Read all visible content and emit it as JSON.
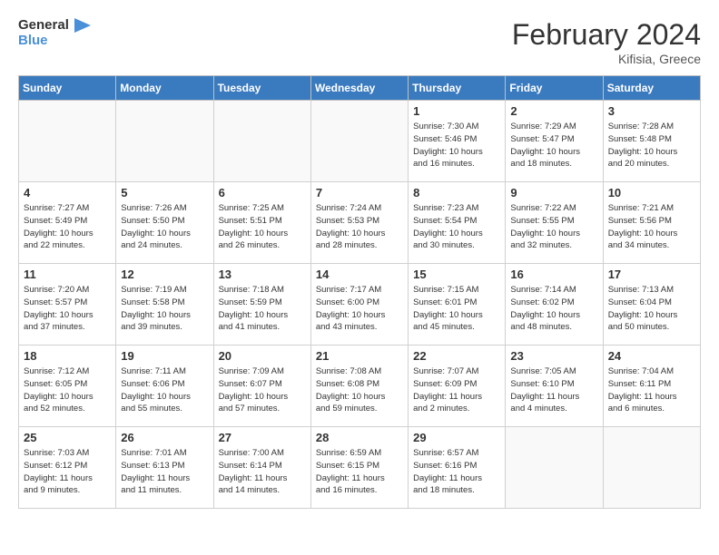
{
  "logo": {
    "line1": "General",
    "line2": "Blue"
  },
  "title": "February 2024",
  "location": "Kifisia, Greece",
  "headers": [
    "Sunday",
    "Monday",
    "Tuesday",
    "Wednesday",
    "Thursday",
    "Friday",
    "Saturday"
  ],
  "weeks": [
    [
      {
        "day": "",
        "info": ""
      },
      {
        "day": "",
        "info": ""
      },
      {
        "day": "",
        "info": ""
      },
      {
        "day": "",
        "info": ""
      },
      {
        "day": "1",
        "info": "Sunrise: 7:30 AM\nSunset: 5:46 PM\nDaylight: 10 hours\nand 16 minutes."
      },
      {
        "day": "2",
        "info": "Sunrise: 7:29 AM\nSunset: 5:47 PM\nDaylight: 10 hours\nand 18 minutes."
      },
      {
        "day": "3",
        "info": "Sunrise: 7:28 AM\nSunset: 5:48 PM\nDaylight: 10 hours\nand 20 minutes."
      }
    ],
    [
      {
        "day": "4",
        "info": "Sunrise: 7:27 AM\nSunset: 5:49 PM\nDaylight: 10 hours\nand 22 minutes."
      },
      {
        "day": "5",
        "info": "Sunrise: 7:26 AM\nSunset: 5:50 PM\nDaylight: 10 hours\nand 24 minutes."
      },
      {
        "day": "6",
        "info": "Sunrise: 7:25 AM\nSunset: 5:51 PM\nDaylight: 10 hours\nand 26 minutes."
      },
      {
        "day": "7",
        "info": "Sunrise: 7:24 AM\nSunset: 5:53 PM\nDaylight: 10 hours\nand 28 minutes."
      },
      {
        "day": "8",
        "info": "Sunrise: 7:23 AM\nSunset: 5:54 PM\nDaylight: 10 hours\nand 30 minutes."
      },
      {
        "day": "9",
        "info": "Sunrise: 7:22 AM\nSunset: 5:55 PM\nDaylight: 10 hours\nand 32 minutes."
      },
      {
        "day": "10",
        "info": "Sunrise: 7:21 AM\nSunset: 5:56 PM\nDaylight: 10 hours\nand 34 minutes."
      }
    ],
    [
      {
        "day": "11",
        "info": "Sunrise: 7:20 AM\nSunset: 5:57 PM\nDaylight: 10 hours\nand 37 minutes."
      },
      {
        "day": "12",
        "info": "Sunrise: 7:19 AM\nSunset: 5:58 PM\nDaylight: 10 hours\nand 39 minutes."
      },
      {
        "day": "13",
        "info": "Sunrise: 7:18 AM\nSunset: 5:59 PM\nDaylight: 10 hours\nand 41 minutes."
      },
      {
        "day": "14",
        "info": "Sunrise: 7:17 AM\nSunset: 6:00 PM\nDaylight: 10 hours\nand 43 minutes."
      },
      {
        "day": "15",
        "info": "Sunrise: 7:15 AM\nSunset: 6:01 PM\nDaylight: 10 hours\nand 45 minutes."
      },
      {
        "day": "16",
        "info": "Sunrise: 7:14 AM\nSunset: 6:02 PM\nDaylight: 10 hours\nand 48 minutes."
      },
      {
        "day": "17",
        "info": "Sunrise: 7:13 AM\nSunset: 6:04 PM\nDaylight: 10 hours\nand 50 minutes."
      }
    ],
    [
      {
        "day": "18",
        "info": "Sunrise: 7:12 AM\nSunset: 6:05 PM\nDaylight: 10 hours\nand 52 minutes."
      },
      {
        "day": "19",
        "info": "Sunrise: 7:11 AM\nSunset: 6:06 PM\nDaylight: 10 hours\nand 55 minutes."
      },
      {
        "day": "20",
        "info": "Sunrise: 7:09 AM\nSunset: 6:07 PM\nDaylight: 10 hours\nand 57 minutes."
      },
      {
        "day": "21",
        "info": "Sunrise: 7:08 AM\nSunset: 6:08 PM\nDaylight: 10 hours\nand 59 minutes."
      },
      {
        "day": "22",
        "info": "Sunrise: 7:07 AM\nSunset: 6:09 PM\nDaylight: 11 hours\nand 2 minutes."
      },
      {
        "day": "23",
        "info": "Sunrise: 7:05 AM\nSunset: 6:10 PM\nDaylight: 11 hours\nand 4 minutes."
      },
      {
        "day": "24",
        "info": "Sunrise: 7:04 AM\nSunset: 6:11 PM\nDaylight: 11 hours\nand 6 minutes."
      }
    ],
    [
      {
        "day": "25",
        "info": "Sunrise: 7:03 AM\nSunset: 6:12 PM\nDaylight: 11 hours\nand 9 minutes."
      },
      {
        "day": "26",
        "info": "Sunrise: 7:01 AM\nSunset: 6:13 PM\nDaylight: 11 hours\nand 11 minutes."
      },
      {
        "day": "27",
        "info": "Sunrise: 7:00 AM\nSunset: 6:14 PM\nDaylight: 11 hours\nand 14 minutes."
      },
      {
        "day": "28",
        "info": "Sunrise: 6:59 AM\nSunset: 6:15 PM\nDaylight: 11 hours\nand 16 minutes."
      },
      {
        "day": "29",
        "info": "Sunrise: 6:57 AM\nSunset: 6:16 PM\nDaylight: 11 hours\nand 18 minutes."
      },
      {
        "day": "",
        "info": ""
      },
      {
        "day": "",
        "info": ""
      }
    ]
  ]
}
